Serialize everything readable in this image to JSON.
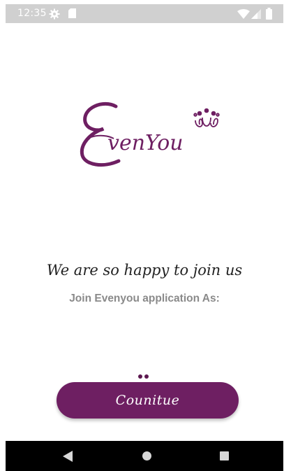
{
  "status_bar": {
    "time": "12:35",
    "icons": [
      "gear-icon",
      "sd-card-icon",
      "wifi-icon",
      "signal-icon",
      "battery-icon"
    ]
  },
  "logo": {
    "text": "EvenYou",
    "color": "#6e1f62"
  },
  "welcome": {
    "headline": "We are so happy to join us",
    "subtitle": "Join Evenyou application As:"
  },
  "pager": {
    "dots": 2
  },
  "continue_button": {
    "label": "Counitue",
    "color": "#6e1f62"
  },
  "nav_bar": {
    "icons": [
      "back-icon",
      "home-icon",
      "recents-icon"
    ]
  }
}
